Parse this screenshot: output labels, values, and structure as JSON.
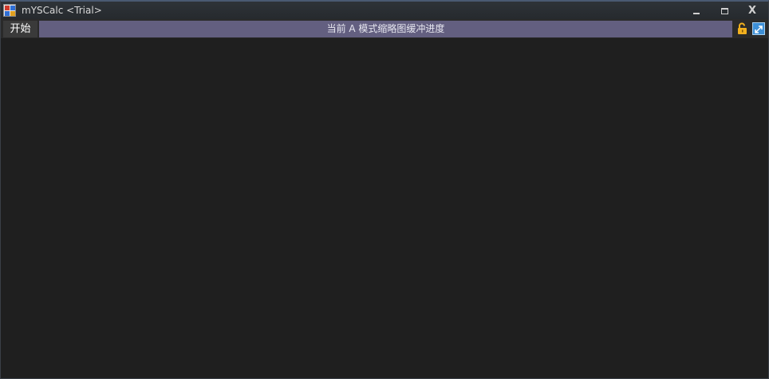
{
  "window": {
    "title": "mYSCalc <Trial>",
    "controls": {
      "minimize": "",
      "maximize": "",
      "close": "X"
    }
  },
  "toolbar": {
    "start_label": "开始",
    "status_text": "当前 A 模式缩略图缓冲进度"
  },
  "icons": [
    "app-icon",
    "lock-icon",
    "expand-icon"
  ],
  "colors": {
    "background": "#1f1f1f",
    "status_bar": "#635f80",
    "lock": "#f2b01e",
    "expand": "#3d8fd6"
  }
}
